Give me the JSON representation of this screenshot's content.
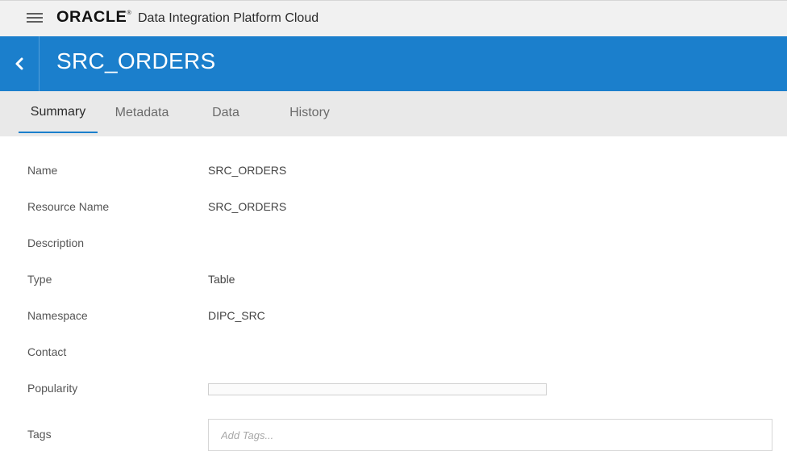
{
  "topbar": {
    "brand": "ORACLE",
    "brand_mark": "®",
    "app_title": "Data Integration Platform Cloud",
    "menu_icon": "hamburger-menu-icon"
  },
  "header": {
    "back_icon": "chevron-left-icon",
    "title": "SRC_ORDERS",
    "accent_color": "#1b7fcc"
  },
  "tabs": [
    {
      "label": "Summary",
      "active": true
    },
    {
      "label": "Metadata",
      "active": false
    },
    {
      "label": "Data",
      "active": false
    },
    {
      "label": "History",
      "active": false
    }
  ],
  "fields": {
    "name": {
      "label": "Name",
      "value": "SRC_ORDERS"
    },
    "resource_name": {
      "label": "Resource Name",
      "value": "SRC_ORDERS"
    },
    "description": {
      "label": "Description",
      "value": ""
    },
    "type": {
      "label": "Type",
      "value": "Table"
    },
    "namespace": {
      "label": "Namespace",
      "value": "DIPC_SRC"
    },
    "contact": {
      "label": "Contact",
      "value": ""
    },
    "popularity": {
      "label": "Popularity",
      "value": 0
    },
    "tags": {
      "label": "Tags",
      "value": "",
      "placeholder": "Add Tags..."
    }
  }
}
